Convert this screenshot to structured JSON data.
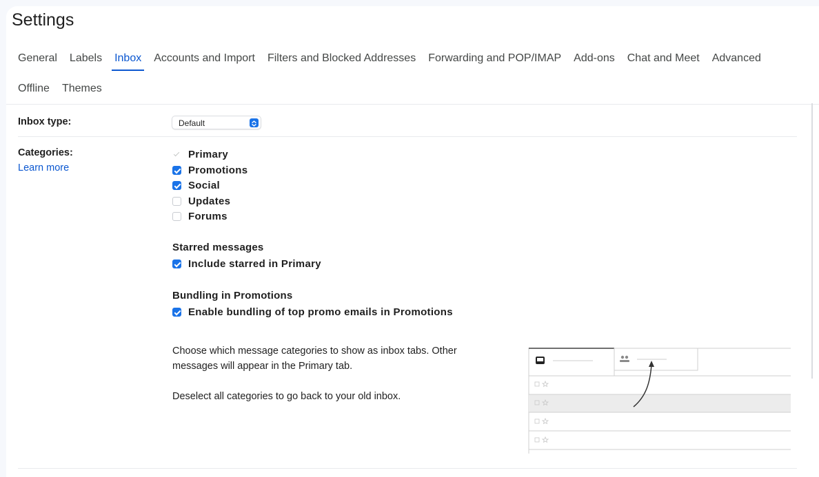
{
  "page": {
    "title": "Settings"
  },
  "tabs": {
    "row1": [
      "General",
      "Labels",
      "Inbox",
      "Accounts and Import",
      "Filters and Blocked Addresses",
      "Forwarding and POP/IMAP",
      "Add-ons",
      "Chat and Meet",
      "Advanced"
    ],
    "row2": [
      "Offline",
      "Themes"
    ],
    "active": "Inbox"
  },
  "inbox_type": {
    "label": "Inbox type:",
    "selected": "Default"
  },
  "categories": {
    "label": "Categories:",
    "learn_more": "Learn more",
    "items": [
      {
        "label": "Primary",
        "state": "checked-disabled"
      },
      {
        "label": "Promotions",
        "state": "checked"
      },
      {
        "label": "Social",
        "state": "checked"
      },
      {
        "label": "Updates",
        "state": "unchecked"
      },
      {
        "label": "Forums",
        "state": "unchecked"
      }
    ]
  },
  "starred": {
    "heading": "Starred messages",
    "option": "Include starred in Primary",
    "checked": true
  },
  "bundling": {
    "heading": "Bundling in Promotions",
    "option": "Enable bundling of top promo emails in Promotions",
    "checked": true
  },
  "description": {
    "line1": "Choose which message categories to show as inbox tabs. Other",
    "line2": "messages will appear in the Primary tab.",
    "line3": "Deselect all categories to go back to your old inbox."
  },
  "colors": {
    "accent": "#0b57d0",
    "checkbox": "#1a73e8",
    "divider": "#e8eaed",
    "background": "#f6f8fc"
  },
  "icons": [
    "inbox-icon",
    "people-icon",
    "checkbox-icon",
    "star-icon",
    "arrow-icon",
    "chevron-updown-icon"
  ]
}
